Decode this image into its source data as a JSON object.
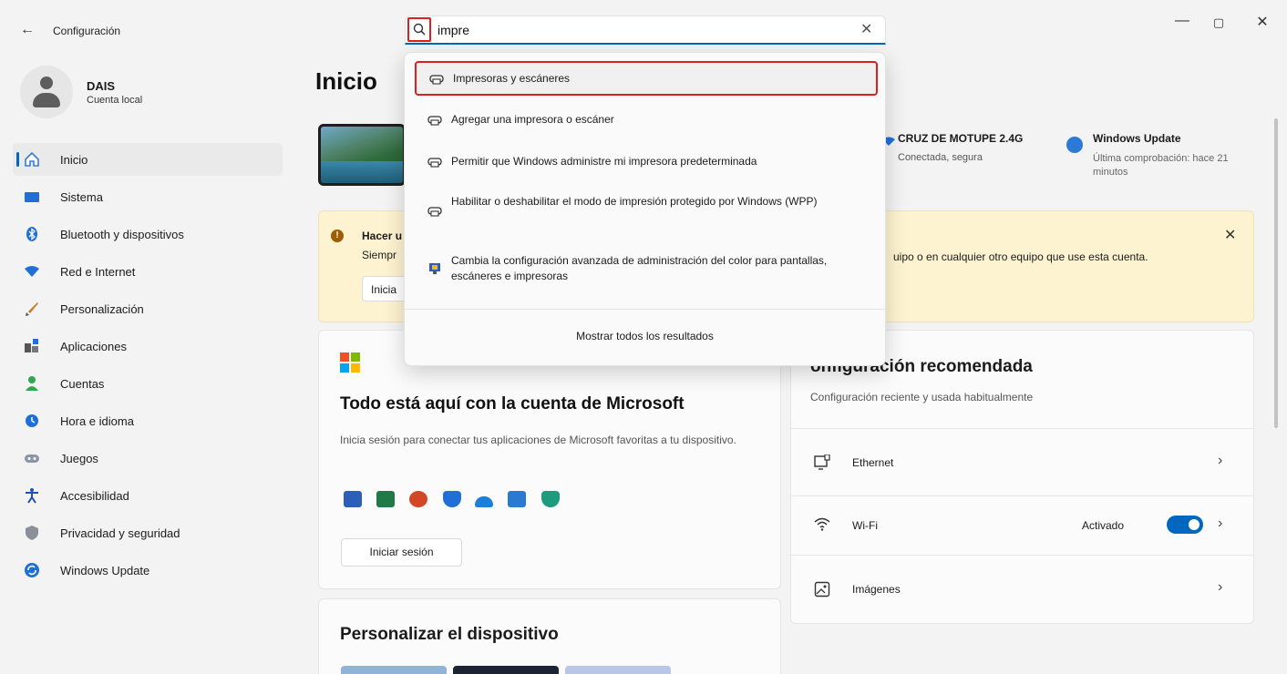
{
  "window": {
    "title": "Configuración",
    "back_glyph": "←",
    "minimize_glyph": "—",
    "restore_glyph": "▢",
    "close_glyph": "✕"
  },
  "search": {
    "value": "impre",
    "clear_glyph": "✕"
  },
  "profile": {
    "name": "DAIS",
    "account_type": "Cuenta local"
  },
  "sidebar": {
    "items": [
      {
        "label": "Inicio",
        "icon": "home-icon",
        "active": true
      },
      {
        "label": "Sistema",
        "icon": "system-icon"
      },
      {
        "label": "Bluetooth y dispositivos",
        "icon": "bluetooth-icon"
      },
      {
        "label": "Red e Internet",
        "icon": "network-icon"
      },
      {
        "label": "Personalización",
        "icon": "brush-icon"
      },
      {
        "label": "Aplicaciones",
        "icon": "apps-icon"
      },
      {
        "label": "Cuentas",
        "icon": "accounts-icon"
      },
      {
        "label": "Hora e idioma",
        "icon": "time-language-icon"
      },
      {
        "label": "Juegos",
        "icon": "gaming-icon"
      },
      {
        "label": "Accesibilidad",
        "icon": "accessibility-icon"
      },
      {
        "label": "Privacidad y seguridad",
        "icon": "shield-icon"
      },
      {
        "label": "Windows Update",
        "icon": "windows-update-icon"
      }
    ]
  },
  "main": {
    "title": "Inicio",
    "wifi": {
      "name": "CRUZ DE MOTUPE 2.4G",
      "status": "Conectada, segura"
    },
    "windows_update": {
      "title": "Windows Update",
      "subtitle": "Última comprobación: hace 21 minutos"
    },
    "banner": {
      "title": "Hacer u",
      "text_left": "Siempr",
      "text_right": "uipo o en cualquier otro equipo que use esta cuenta.",
      "button": "Inicia",
      "close_glyph": "✕"
    },
    "ms_card": {
      "title": "Todo está aquí con la cuenta de Microsoft",
      "description": "Inicia sesión para conectar tus aplicaciones de Microsoft favoritas a tu dispositivo.",
      "button": "Iniciar sesión"
    },
    "personalize": {
      "title": "Personalizar el dispositivo"
    },
    "recommended": {
      "title": "Configuración recomendada",
      "title_visible": "onfiguración recomendada",
      "subtitle": "Configuración reciente y usada habitualmente",
      "items": [
        {
          "label": "Ethernet",
          "icon": "ethernet-icon"
        },
        {
          "label": "Wi-Fi",
          "icon": "wifi-icon",
          "state": "Activado",
          "toggle_on": true
        },
        {
          "label": "Imágenes",
          "icon": "images-icon"
        }
      ],
      "chevron_glyph": "›"
    }
  },
  "dropdown": {
    "results": [
      {
        "text": "Impresoras y escáneres",
        "icon": "printer-icon",
        "highlighted": true
      },
      {
        "text": "Agregar una impresora o escáner",
        "icon": "printer-icon"
      },
      {
        "text": "Permitir que Windows administre mi impresora predeterminada",
        "icon": "printer-icon"
      },
      {
        "text": "Habilitar o deshabilitar el modo de impresión protegido por Windows (WPP)",
        "icon": "printer-icon"
      },
      {
        "text": "Cambia la configuración avanzada de administración del color para pantallas, escáneres e impresoras",
        "icon": "color-management-icon"
      }
    ],
    "show_all": "Mostrar todos los resultados"
  },
  "colors": {
    "accent": "#0067c0",
    "highlight_border": "#e01e1e",
    "banner_bg": "#fdf3d0"
  }
}
